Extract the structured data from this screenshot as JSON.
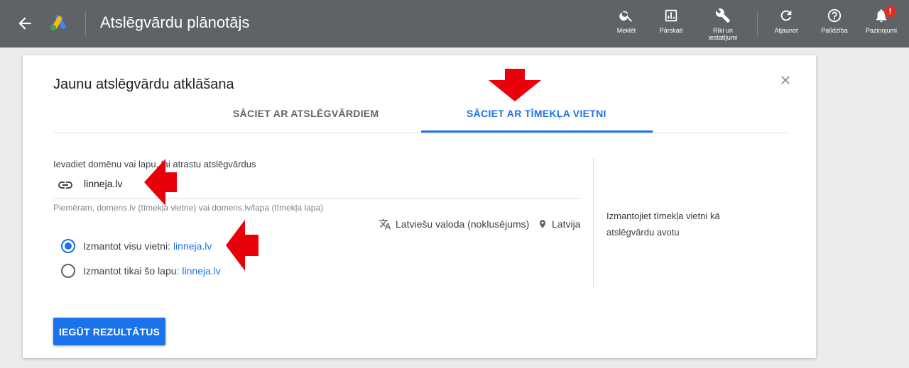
{
  "header": {
    "title": "Atslēgvārdu plānotājs",
    "tools": [
      {
        "label": "Meklēt",
        "icon": "search-icon"
      },
      {
        "label": "Pārskati",
        "icon": "reports-icon"
      },
      {
        "label": "Rīki un iestatījumi",
        "icon": "wrench-icon"
      },
      {
        "label": "Atjaunot",
        "icon": "refresh-icon"
      },
      {
        "label": "Palīdzība",
        "icon": "help-icon"
      },
      {
        "label": "Paziņojumi",
        "icon": "bell-icon",
        "badge": "!"
      }
    ]
  },
  "dialog": {
    "title": "Jaunu atslēgvārdu atklāšana",
    "tabs": [
      {
        "label": "SĀCIET AR ATSLĒGVĀRDIEM",
        "active": false
      },
      {
        "label": "SĀCIET AR TĪMEKĻA VIETNI",
        "active": true
      }
    ],
    "field_label": "Ievadiet domēnu vai lapu, lai atrastu atslēgvārdus",
    "url_value": "linneja.lv",
    "hint": "Piemēram, domens.lv (tīmekļa vietne) vai domens.lv/lapa (tīmekļa lapa)",
    "language": "Latviešu valoda (noklusējums)",
    "location": "Latvija",
    "radio_options": [
      {
        "label": "Izmantot visu vietni:",
        "domain": "linneja.lv",
        "checked": true
      },
      {
        "label": "Izmantot tikai šo lapu:",
        "domain": "linneja.lv",
        "checked": false
      }
    ],
    "side_text": "Izmantojiet tīmekļa vietni kā atslēgvārdu avotu",
    "submit_label": "IEGŪT REZULTĀTUS"
  },
  "colors": {
    "topbar": "#5f6368",
    "accent": "#1a73e8",
    "annotation_arrow": "#e8000b"
  }
}
